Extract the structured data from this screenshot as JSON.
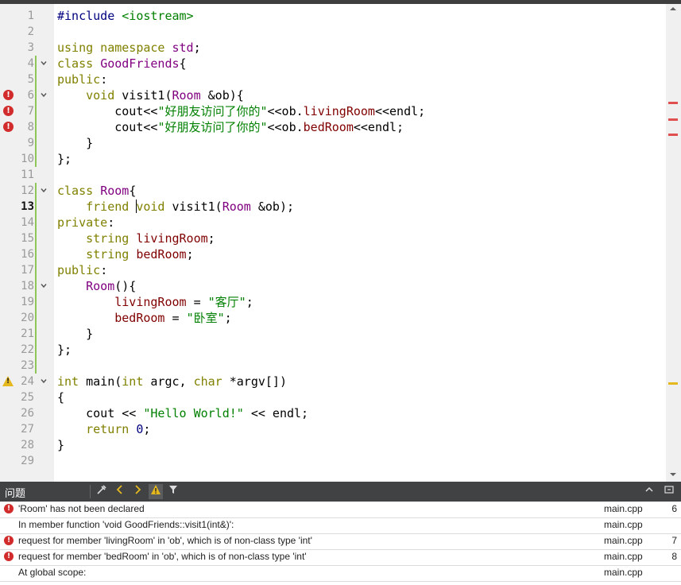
{
  "editor": {
    "lines": [
      {
        "n": "1",
        "code": [
          {
            "c": "pp",
            "t": "#include "
          },
          {
            "c": "st",
            "t": "<iostream>"
          }
        ]
      },
      {
        "n": "2",
        "code": []
      },
      {
        "n": "3",
        "code": [
          {
            "c": "kw",
            "t": "using namespace "
          },
          {
            "c": "ty",
            "t": "std"
          },
          {
            "c": "",
            "t": ";"
          }
        ]
      },
      {
        "n": "4",
        "fold": true,
        "code": [
          {
            "c": "kw",
            "t": "class "
          },
          {
            "c": "ty",
            "t": "GoodFriends"
          },
          {
            "c": "",
            "t": "{"
          }
        ]
      },
      {
        "n": "5",
        "code": [
          {
            "c": "kw",
            "t": "public"
          },
          {
            "c": "",
            "t": ":"
          }
        ]
      },
      {
        "n": "6",
        "fold": true,
        "error": true,
        "code": [
          {
            "c": "",
            "t": "    "
          },
          {
            "c": "kw",
            "t": "void "
          },
          {
            "c": "",
            "t": "visit1("
          },
          {
            "c": "ty",
            "t": "Room"
          },
          {
            "c": "",
            "t": " &ob){"
          }
        ]
      },
      {
        "n": "7",
        "error": true,
        "code": [
          {
            "c": "",
            "t": "        cout<<"
          },
          {
            "c": "st",
            "t": "\"好朋友访问了你的\""
          },
          {
            "c": "",
            "t": "<<ob."
          },
          {
            "c": "mb",
            "t": "livingRoom"
          },
          {
            "c": "",
            "t": "<<endl;"
          }
        ]
      },
      {
        "n": "8",
        "error": true,
        "code": [
          {
            "c": "",
            "t": "        cout<<"
          },
          {
            "c": "st",
            "t": "\"好朋友访问了你的\""
          },
          {
            "c": "",
            "t": "<<ob."
          },
          {
            "c": "mb",
            "t": "bedRoom"
          },
          {
            "c": "",
            "t": "<<endl;"
          }
        ]
      },
      {
        "n": "9",
        "code": [
          {
            "c": "",
            "t": "    }"
          }
        ]
      },
      {
        "n": "10",
        "code": [
          {
            "c": "",
            "t": "};"
          }
        ]
      },
      {
        "n": "11",
        "code": []
      },
      {
        "n": "12",
        "fold": true,
        "code": [
          {
            "c": "kw",
            "t": "class "
          },
          {
            "c": "ty",
            "t": "Room"
          },
          {
            "c": "",
            "t": "{"
          }
        ]
      },
      {
        "n": "13",
        "current": true,
        "code": [
          {
            "c": "",
            "t": "    "
          },
          {
            "c": "kw",
            "t": "friend "
          },
          {
            "cursor": true
          },
          {
            "c": "kw",
            "t": "void "
          },
          {
            "c": "",
            "t": "visit1("
          },
          {
            "c": "ty",
            "t": "Room"
          },
          {
            "c": "",
            "t": " &ob);"
          }
        ]
      },
      {
        "n": "14",
        "code": [
          {
            "c": "kw",
            "t": "private"
          },
          {
            "c": "",
            "t": ":"
          }
        ]
      },
      {
        "n": "15",
        "code": [
          {
            "c": "",
            "t": "    "
          },
          {
            "c": "kw",
            "t": "string "
          },
          {
            "c": "mb",
            "t": "livingRoom"
          },
          {
            "c": "",
            "t": ";"
          }
        ]
      },
      {
        "n": "16",
        "code": [
          {
            "c": "",
            "t": "    "
          },
          {
            "c": "kw",
            "t": "string "
          },
          {
            "c": "mb",
            "t": "bedRoom"
          },
          {
            "c": "",
            "t": ";"
          }
        ]
      },
      {
        "n": "17",
        "code": [
          {
            "c": "kw",
            "t": "public"
          },
          {
            "c": "",
            "t": ":"
          }
        ]
      },
      {
        "n": "18",
        "fold": true,
        "code": [
          {
            "c": "",
            "t": "    "
          },
          {
            "c": "ty",
            "t": "Room"
          },
          {
            "c": "",
            "t": "(){"
          }
        ]
      },
      {
        "n": "19",
        "code": [
          {
            "c": "",
            "t": "        "
          },
          {
            "c": "mb",
            "t": "livingRoom"
          },
          {
            "c": "",
            "t": " = "
          },
          {
            "c": "st",
            "t": "\"客厅\""
          },
          {
            "c": "",
            "t": ";"
          }
        ]
      },
      {
        "n": "20",
        "code": [
          {
            "c": "",
            "t": "        "
          },
          {
            "c": "mb",
            "t": "bedRoom"
          },
          {
            "c": "",
            "t": " = "
          },
          {
            "c": "st",
            "t": "\"卧室\""
          },
          {
            "c": "",
            "t": ";"
          }
        ]
      },
      {
        "n": "21",
        "code": [
          {
            "c": "",
            "t": "    }"
          }
        ]
      },
      {
        "n": "22",
        "code": [
          {
            "c": "",
            "t": "};"
          }
        ]
      },
      {
        "n": "23",
        "code": []
      },
      {
        "n": "24",
        "fold": true,
        "warning": true,
        "code": [
          {
            "c": "kw",
            "t": "int "
          },
          {
            "c": "",
            "t": "main("
          },
          {
            "c": "kw",
            "t": "int "
          },
          {
            "c": "",
            "t": "argc, "
          },
          {
            "c": "kw",
            "t": "char "
          },
          {
            "c": "",
            "t": "*argv[])"
          }
        ]
      },
      {
        "n": "25",
        "code": [
          {
            "c": "",
            "t": "{"
          }
        ]
      },
      {
        "n": "26",
        "code": [
          {
            "c": "",
            "t": "    cout << "
          },
          {
            "c": "st",
            "t": "\"Hello World!\""
          },
          {
            "c": "",
            "t": " << endl;"
          }
        ]
      },
      {
        "n": "27",
        "code": [
          {
            "c": "",
            "t": "    "
          },
          {
            "c": "kw",
            "t": "return "
          },
          {
            "c": "nm",
            "t": "0"
          },
          {
            "c": "",
            "t": ";"
          }
        ]
      },
      {
        "n": "28",
        "code": [
          {
            "c": "",
            "t": "}"
          }
        ]
      },
      {
        "n": "29",
        "code": []
      }
    ]
  },
  "issues": {
    "title": "问题",
    "prev_icon": "chevron-left-icon",
    "next_icon": "chevron-right-icon",
    "warning_filter_icon": "warning-icon",
    "filter_icon": "filter-icon",
    "collapse_icon": "chevron-up-icon",
    "close_icon": "close-panel-icon",
    "rows": [
      {
        "error": true,
        "message": "'Room' has not been declared",
        "file": "main.cpp",
        "line": "6"
      },
      {
        "error": false,
        "message": "In member function 'void GoodFriends::visit1(int&)':",
        "file": "main.cpp",
        "line": ""
      },
      {
        "error": true,
        "message": "request for member 'livingRoom' in 'ob', which is of non-class type 'int'",
        "file": "main.cpp",
        "line": "7"
      },
      {
        "error": true,
        "message": "request for member 'bedRoom' in 'ob', which is of non-class type 'int'",
        "file": "main.cpp",
        "line": "8"
      },
      {
        "error": false,
        "message": "At global scope:",
        "file": "main.cpp",
        "line": ""
      }
    ]
  },
  "colors": {
    "error": "#d22b2b",
    "warning": "#e5b81e",
    "changed": "#8fc65a",
    "panel_header": "#404244"
  }
}
